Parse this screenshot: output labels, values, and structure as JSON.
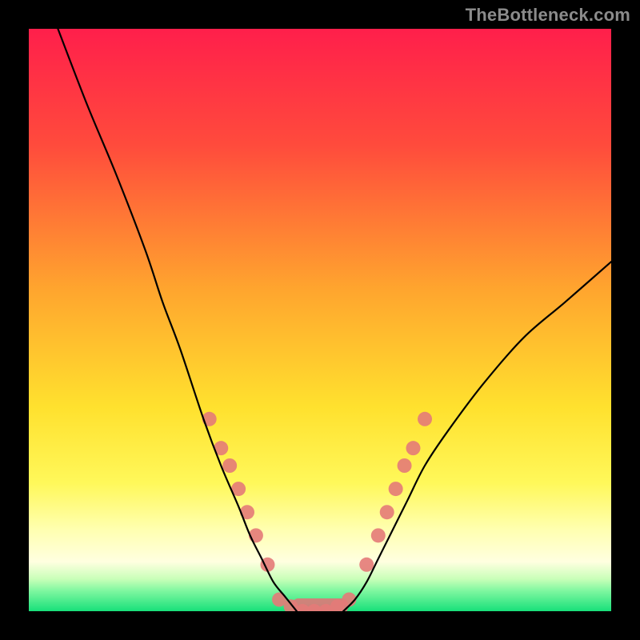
{
  "watermark": "TheBottleneck.com",
  "chart_data": {
    "type": "line",
    "title": "",
    "xlabel": "",
    "ylabel": "",
    "xlim": [
      0,
      100
    ],
    "ylim": [
      0,
      100
    ],
    "gradient_stops": [
      {
        "pos": 0.0,
        "color": "#ff1f4b"
      },
      {
        "pos": 0.2,
        "color": "#ff4b3c"
      },
      {
        "pos": 0.45,
        "color": "#ffa62e"
      },
      {
        "pos": 0.65,
        "color": "#ffe12e"
      },
      {
        "pos": 0.78,
        "color": "#fff85a"
      },
      {
        "pos": 0.86,
        "color": "#ffffb0"
      },
      {
        "pos": 0.915,
        "color": "#ffffe0"
      },
      {
        "pos": 0.945,
        "color": "#c8ffb8"
      },
      {
        "pos": 0.965,
        "color": "#7ff7a0"
      },
      {
        "pos": 1.0,
        "color": "#18e07a"
      }
    ],
    "series": [
      {
        "name": "left-curve",
        "x": [
          5,
          10,
          15,
          20,
          23,
          26,
          30,
          33,
          36,
          38,
          40,
          42,
          44,
          46
        ],
        "y": [
          100,
          87,
          75,
          62,
          53,
          45,
          33,
          25,
          18,
          13,
          9,
          5,
          2.5,
          0
        ]
      },
      {
        "name": "right-curve",
        "x": [
          54,
          56,
          58,
          60,
          62,
          65,
          68,
          72,
          78,
          85,
          92,
          100
        ],
        "y": [
          0,
          2,
          5,
          9,
          13,
          19,
          25,
          31,
          39,
          47,
          53,
          60
        ]
      },
      {
        "name": "plateau",
        "x": [
          46,
          48,
          50,
          52,
          54
        ],
        "y": [
          0,
          0,
          0,
          0,
          0
        ]
      },
      {
        "name": "plateau-markers",
        "type": "scatter",
        "x": [
          43,
          45,
          47,
          49,
          51,
          53,
          55
        ],
        "y": [
          2,
          0.8,
          0,
          0,
          0,
          0.8,
          2
        ]
      },
      {
        "name": "left-markers",
        "type": "scatter",
        "x": [
          31,
          33,
          34.5,
          36,
          37.5,
          39,
          41
        ],
        "y": [
          33,
          28,
          25,
          21,
          17,
          13,
          8
        ]
      },
      {
        "name": "right-markers",
        "type": "scatter",
        "x": [
          58,
          60,
          61.5,
          63,
          64.5,
          66,
          68
        ],
        "y": [
          8,
          13,
          17,
          21,
          25,
          28,
          33
        ]
      }
    ]
  }
}
